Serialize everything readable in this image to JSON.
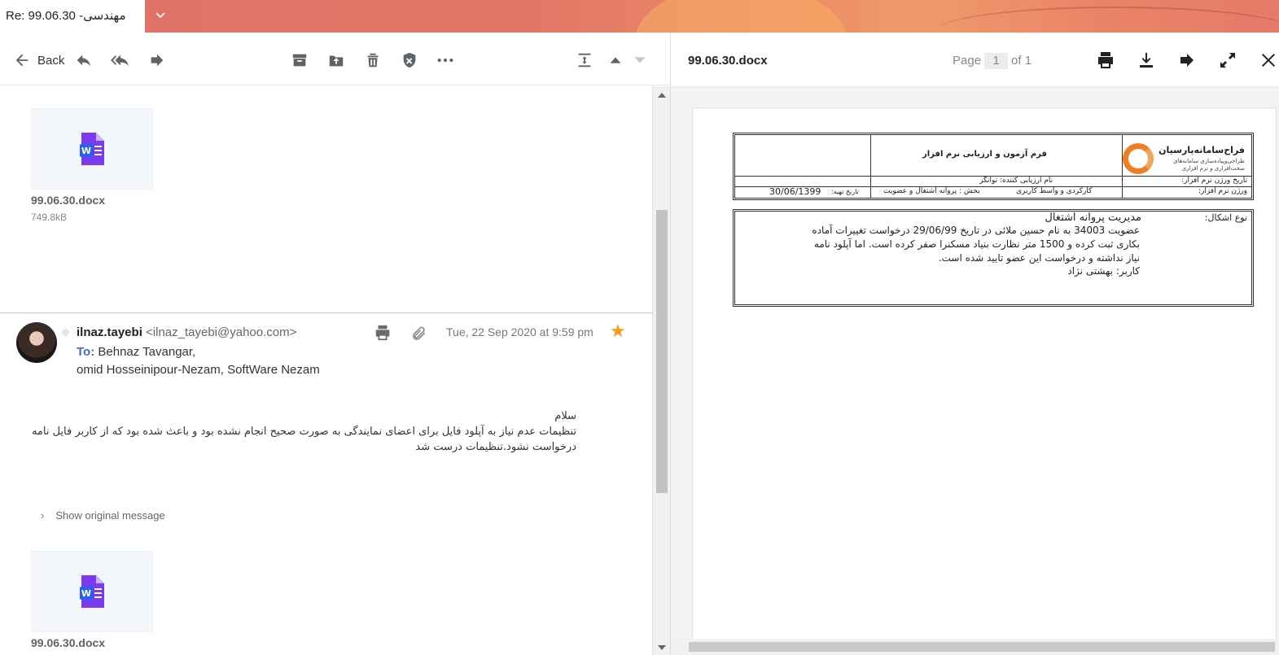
{
  "window": {
    "tab_title": "Re: 99.06.30 -مهندسی",
    "tab_chevron": "⌄"
  },
  "toolbar": {
    "back_label": "Back",
    "icons": [
      "back-arrow-icon",
      "reply-icon",
      "reply-all-icon",
      "forward-icon",
      "archive-icon",
      "move-icon",
      "delete-icon",
      "spam-shield-icon",
      "more-icon",
      "expand-collapse-icon",
      "previous-icon",
      "next-icon"
    ]
  },
  "attachments": [
    {
      "name": "99.06.30.docx",
      "size": "749.8kB"
    },
    {
      "name": "99.06.30.docx",
      "size": ""
    }
  ],
  "message": {
    "sender_name": "ilnaz.tayebi",
    "sender_email": "<ilnaz_tayebi@yahoo.com>",
    "to_label": "To:",
    "recipients_line1": "Behnaz Tavangar,",
    "recipients_line2": "omid Hosseinipour-Nezam,  SoftWare Nezam",
    "date": "Tue, 22 Sep 2020 at 9:59 pm",
    "starred": true,
    "body_line1": "سلام",
    "body_line2": "تنظیمات عدم نیاز به آپلود فایل برای اعضای نمایندگی به صورت صحیح انجام نشده بود و باعث شده بود که از کاربر فایل نامه",
    "body_line3": "درخواست نشود.تنظیمات درست شد",
    "show_original": "Show original message"
  },
  "preview": {
    "doc_name": "99.06.30.docx",
    "page_label": "Page",
    "page_current": "1",
    "page_of": "of 1",
    "tools": [
      "print-icon",
      "download-icon",
      "forward-icon",
      "fullscreen-icon",
      "close-icon"
    ]
  },
  "document": {
    "logo_title": "فراح‌سامانه‌پارسیان",
    "logo_line1": "طراحی‌وپیاده‌سازی سامانه‌های",
    "logo_line2": "سخت‌افزاری و نرم افزاری",
    "form_title": "فرم آزمون و ارزیابی نرم افزار",
    "eval_name_label": "نام ارزیابی کننده: توانگر",
    "version_date_label": "تاریخ ورژن نرم افزار:",
    "version_label": "ورژن نرم افزار:",
    "module_label": "کارکردی و واسط کاربری",
    "section_label": "بخش : پروانه اشتغال و عضویت",
    "prep_date_label": "تاریخ تهیه:",
    "prep_date": "30/06/1399",
    "issue_type_label": "نوع اشکال:",
    "issue_title": "مدیریت پروانه اشتغال",
    "issue_line1": "عضویت 34003 به نام حسین ملائی در تاریخ 29/06/99 درخواست تغییرات آماده",
    "issue_line2": "بکاری ثبت کرده و 1500 متر نظارت بنیاد مسکنرا صفر کرده است. اما آپلود نامه",
    "issue_line3": "نیاز نداشته و درخواست این عضو تایید شده است.",
    "issue_line4": "کاربر: بهشتی نژاد"
  }
}
